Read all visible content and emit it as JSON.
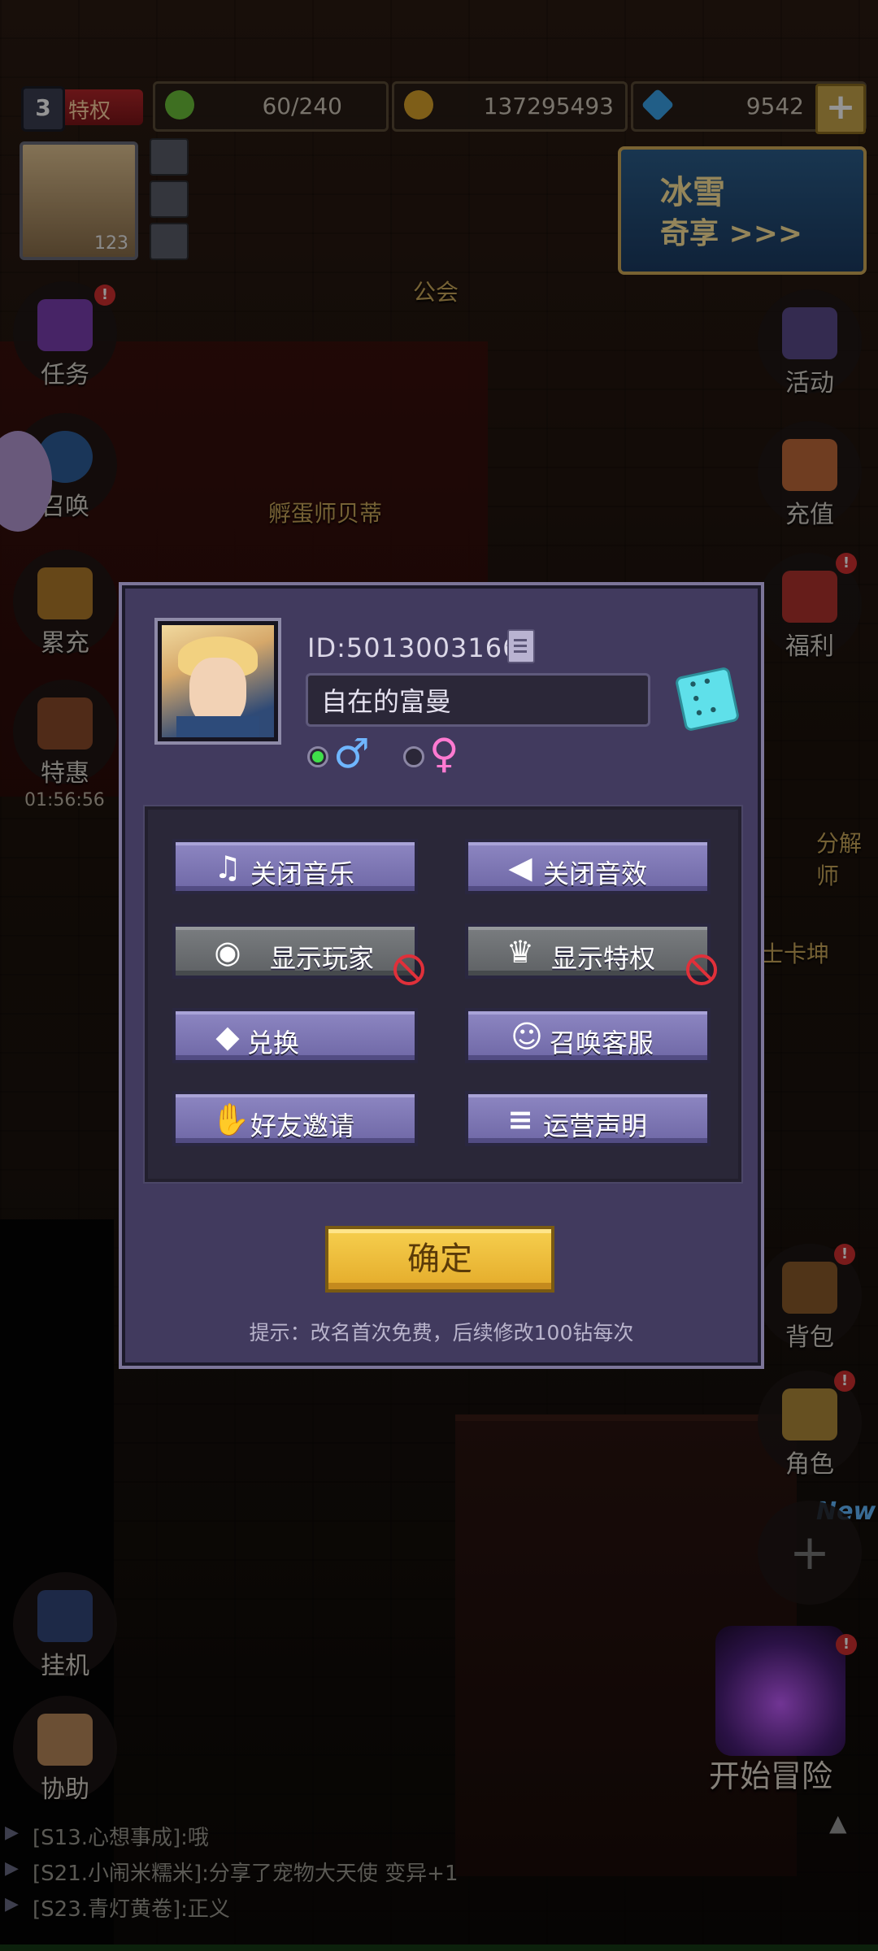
{
  "top_bar": {
    "vip_level": "3",
    "vip_label": "特权",
    "stamina": "60/240",
    "gold": "137295493",
    "diamonds": "9542",
    "plus": "+"
  },
  "player_card": {
    "level": "123"
  },
  "event_banner": {
    "line1": "冰雪",
    "line2": "奇享 >>>"
  },
  "left_menu": [
    {
      "label": "任务"
    },
    {
      "label": "召唤"
    },
    {
      "label": "累充"
    },
    {
      "label": "特惠"
    }
  ],
  "timer": "01:56:56",
  "right_menu": [
    {
      "label": "活动"
    },
    {
      "label": "充值"
    },
    {
      "label": "福利"
    },
    {
      "label": "背包"
    },
    {
      "label": "角色"
    }
  ],
  "bottom_left": [
    {
      "label": "挂机"
    },
    {
      "label": "协助"
    }
  ],
  "scene_labels": {
    "guild": "公会",
    "egg_master": "孵蛋师贝蒂",
    "decompose": "分解师",
    "knight": "士卡坤",
    "new_tag": "New",
    "start_adventure": "开始冒险"
  },
  "chat": [
    "[S13.心想事成]:哦",
    "[S21.小闹米糯米]:分享了宠物大天使 变异+1",
    "[S23.青灯黄卷]:正义"
  ],
  "dialog": {
    "player_id": "ID:5013003166",
    "nickname": "自在的富曼",
    "gender_male": "♂",
    "gender_female": "♀",
    "selected_gender": "male",
    "buttons": [
      {
        "label": "关闭音乐",
        "icon": "music-note-icon",
        "glyph": "♫",
        "style": "purple"
      },
      {
        "label": "关闭音效",
        "icon": "speaker-icon",
        "glyph": "◀",
        "style": "purple"
      },
      {
        "label": "显示玩家",
        "icon": "eye-icon",
        "glyph": "◉",
        "style": "gray",
        "disabled": true
      },
      {
        "label": "显示特权",
        "icon": "crown-icon",
        "glyph": "♛",
        "style": "gray",
        "disabled": true
      },
      {
        "label": "兑换",
        "icon": "bag-icon",
        "glyph": "◆",
        "style": "purple"
      },
      {
        "label": "召唤客服",
        "icon": "headset-icon",
        "glyph": "☺",
        "style": "purple"
      },
      {
        "label": "好友邀请",
        "icon": "handshake-icon",
        "glyph": "✋",
        "style": "purple"
      },
      {
        "label": "运营声明",
        "icon": "document-icon",
        "glyph": "≡",
        "style": "purple"
      }
    ],
    "confirm_label": "确定",
    "hint": "提示：改名首次免费，后续修改100钻每次"
  },
  "colors": {
    "dialog_bg": "#413a5e",
    "button_purple": "#7f78b5",
    "button_gray": "#6b6e71",
    "confirm_gold": "#f0c040",
    "male_blue": "#6fb6ff",
    "female_pink": "#ff7ad1",
    "radio_green": "#3fe04a"
  }
}
